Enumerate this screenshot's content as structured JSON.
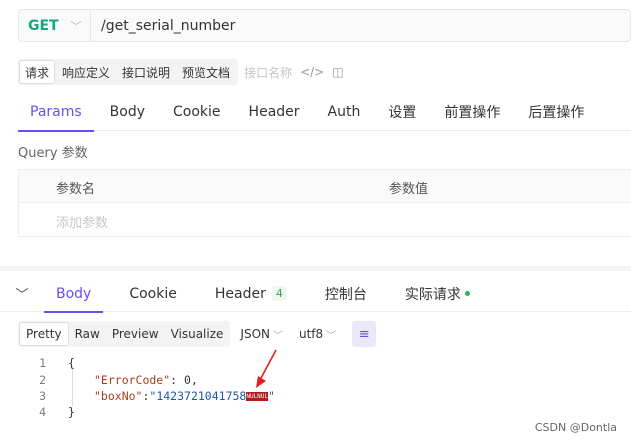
{
  "request": {
    "method": "GET",
    "url": "/get_serial_number"
  },
  "subtabs": [
    "请求",
    "响应定义",
    "接口说明",
    "预览文档"
  ],
  "api_name_placeholder": "接口名称",
  "param_tabs": [
    "Params",
    "Body",
    "Cookie",
    "Header",
    "Auth",
    "设置",
    "前置操作",
    "后置操作"
  ],
  "query_label": "Query 参数",
  "query_table": {
    "headers": [
      "参数名",
      "参数值"
    ],
    "add_placeholder": "添加参数"
  },
  "response_tabs": {
    "body": "Body",
    "cookie": "Cookie",
    "header": "Header",
    "header_count": "4",
    "console": "控制台",
    "actual_request": "实际请求"
  },
  "view_modes": [
    "Pretty",
    "Raw",
    "Preview",
    "Visualize"
  ],
  "format_select": "JSON",
  "encoding_select": "utf8",
  "code_lines": {
    "l1": "{",
    "l2_key": "\"ErrorCode\"",
    "l2_val": "0",
    "l3_key": "\"boxNo\"",
    "l3_val": "\"1423721041758",
    "l3_nul": "NULNUL",
    "l3_end": "\"",
    "l4": "}"
  },
  "line_numbers": [
    "1",
    "2",
    "3",
    "4"
  ],
  "watermark": "CSDN @Dontla",
  "colors": {
    "accent": "#6a4ff0",
    "method_get": "#15a87f",
    "nul_badge": "#b31b1b",
    "arrow": "#e02020"
  }
}
